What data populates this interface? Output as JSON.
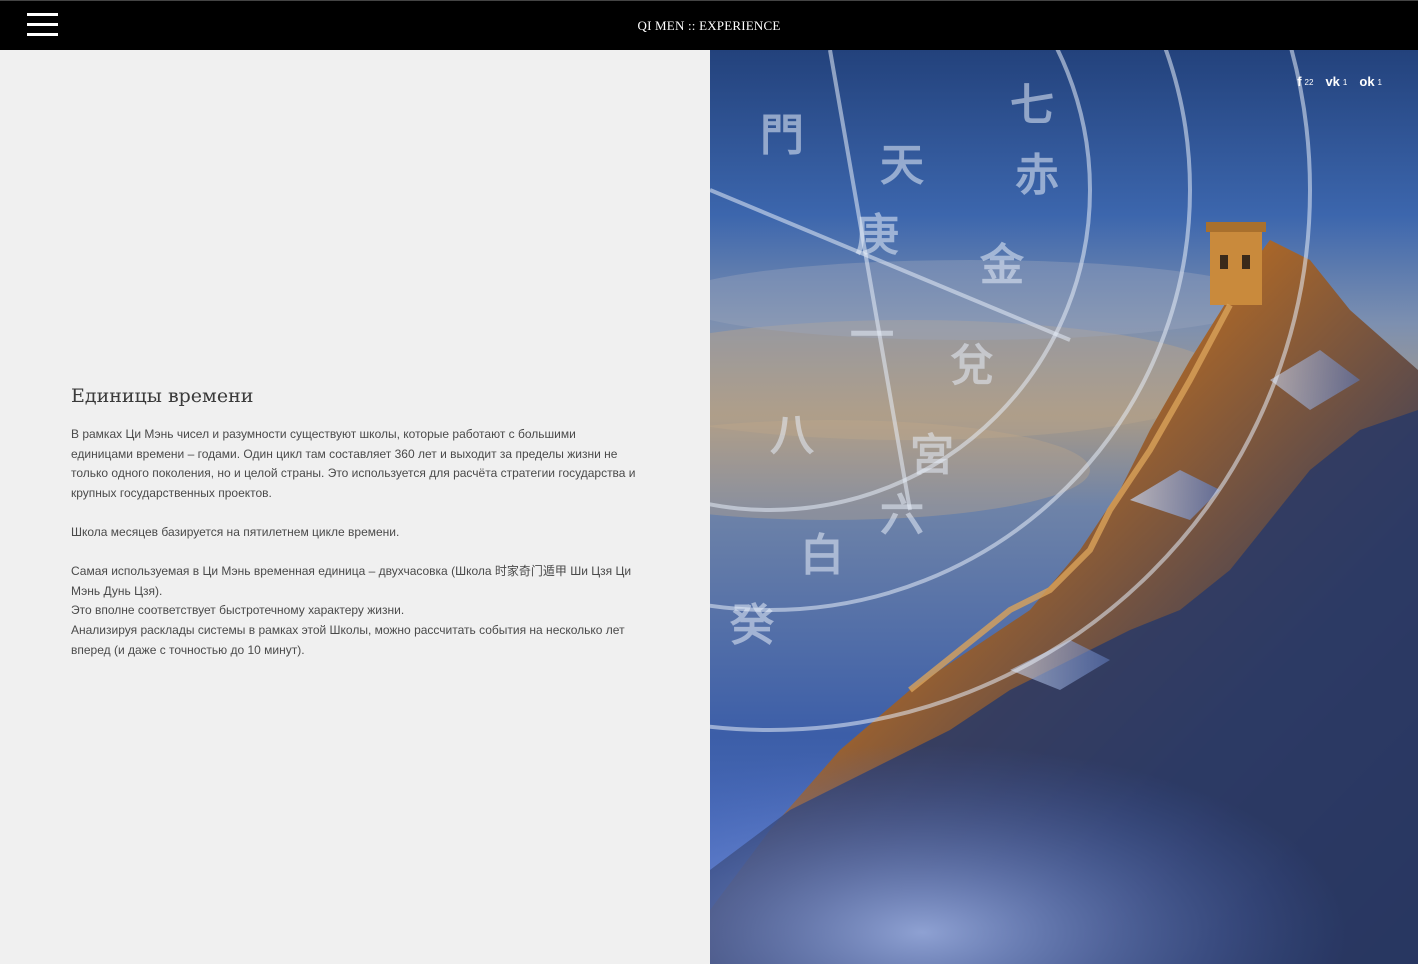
{
  "header": {
    "site_title": "QI MEN :: EXPERIENCE",
    "menu_icon": "hamburger-menu-icon"
  },
  "article": {
    "title": "Единицы времени",
    "paragraphs": [
      "В рамках Ци Мэнь чисел и разумности существуют школы, которые работают с большими единицами времени – годами. Один цикл там составляет 360 лет и выходит за пределы жизни не только одного поколения, но и целой страны. Это используется для расчёта стратегии государства и крупных государственных проектов.",
      "Школа месяцев базируется на пятилетнем цикле времени.",
      "Самая используемая в Ци Мэнь временная единица – двухчасовка (Школа 时家奇门遁甲 Ши Цзя Ци Мэнь Дунь Цзя).",
      "Это вполне соответствует быстротечному характеру жизни.",
      "Анализируя расклады системы в рамках этой Школы, можно рассчитать события на несколько лет вперед (и даже с точностью до 10 минут)."
    ]
  },
  "share": {
    "facebook": {
      "icon": "f",
      "count": "22"
    },
    "vk": {
      "icon": "vk",
      "count": "1"
    },
    "odnoklassniki": {
      "icon": "ok",
      "count": "1"
    }
  },
  "image": {
    "description_icon": "great-wall-photo",
    "overlay_glyphs": [
      "七",
      "赤",
      "金",
      "兌",
      "宮",
      "六",
      "白",
      "天",
      "庚",
      "一",
      "八",
      "門",
      "癸"
    ]
  },
  "colors": {
    "topbar_bg": "#000000",
    "left_bg": "#f0f0f0",
    "title_color": "#3a3a3a",
    "text_color": "#4a4a4a"
  }
}
